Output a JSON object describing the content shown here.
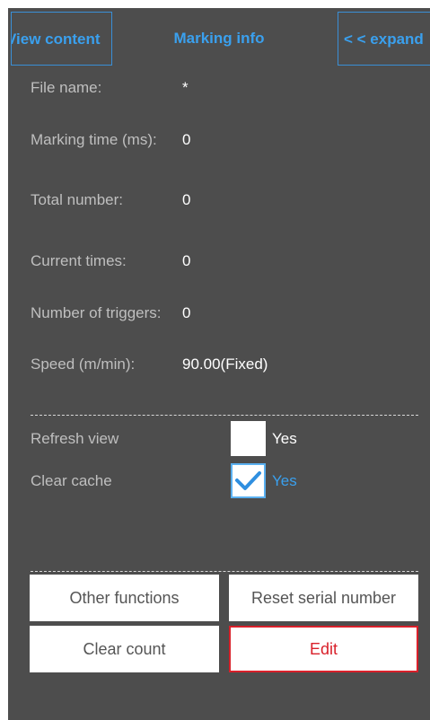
{
  "tabs": {
    "view_content": "View content",
    "marking_info": "Marking info",
    "expand": "< < expand"
  },
  "info": [
    {
      "label": "File name:",
      "value": "*"
    },
    {
      "label": "Marking time (ms):",
      "value": "0"
    },
    {
      "label": "Total number:",
      "value": "0"
    },
    {
      "label": "Current times:",
      "value": "0"
    },
    {
      "label": "Number of triggers:",
      "value": "0"
    },
    {
      "label": "Speed (m/min):",
      "value": "90.00(Fixed)"
    }
  ],
  "options": {
    "refresh_view": {
      "label": "Refresh view",
      "yes": "Yes",
      "checked": false
    },
    "clear_cache": {
      "label": "Clear cache",
      "yes": "Yes",
      "checked": true
    }
  },
  "buttons": {
    "other_functions": "Other functions",
    "reset_serial": "Reset serial number",
    "clear_count": "Clear count",
    "edit": "Edit"
  },
  "colors": {
    "background": "#4d4d4d",
    "accent_blue": "#3aa0ee",
    "label_gray": "#bfbfbf",
    "edit_red": "#d9202a"
  }
}
